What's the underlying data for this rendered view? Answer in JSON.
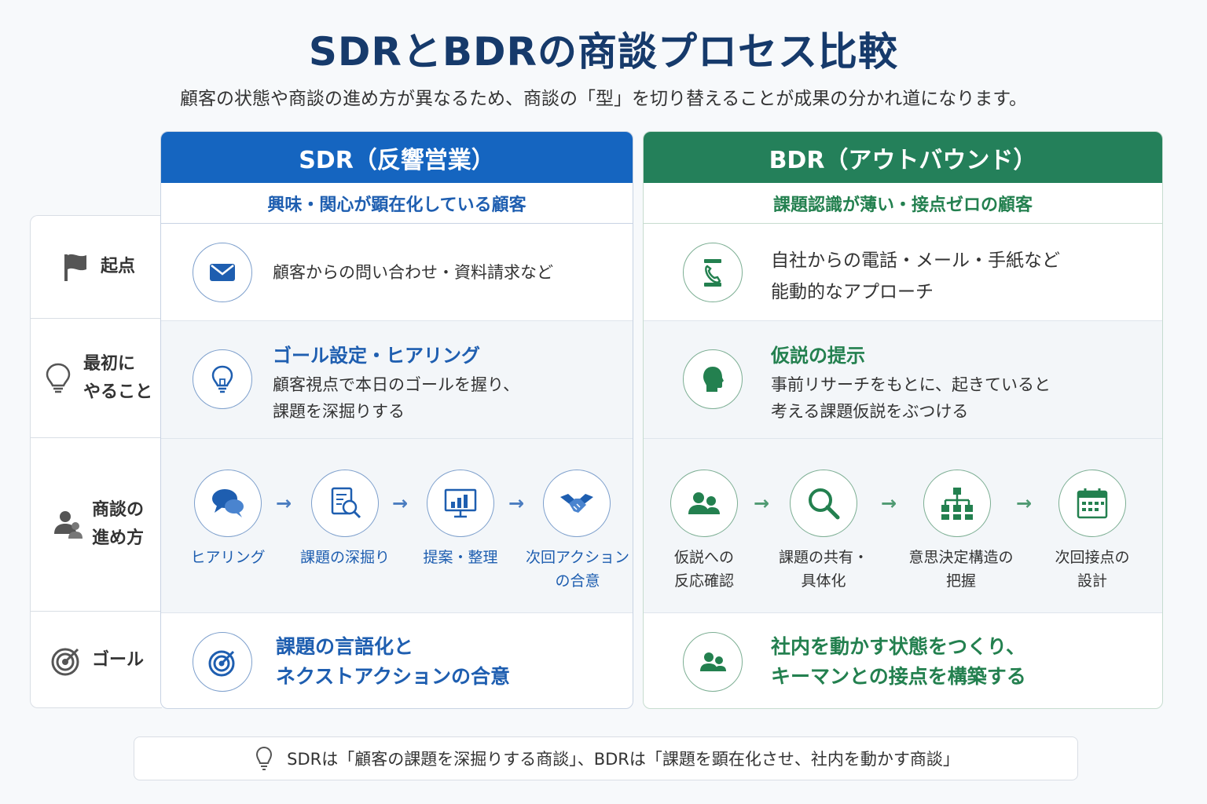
{
  "title": "SDRとBDRの商談プロセス比較",
  "subtitle": "顧客の状態や商談の進め方が異なるため、商談の「型」を切り替えることが成果の分かれ道になります。",
  "row_labels": [
    {
      "label": "起点",
      "icon": "flag-icon"
    },
    {
      "label": "最初に\nやること",
      "icon": "lightbulb-icon"
    },
    {
      "label": "商談の\n進め方",
      "icon": "people-icon"
    },
    {
      "label": "ゴール",
      "icon": "target-icon"
    }
  ],
  "sdr": {
    "header": "SDR（反響営業）",
    "subheader": "興味・関心が顕在化している顧客",
    "color": "#1565c0",
    "start": {
      "icon": "envelope-icon",
      "text": "顧客からの問い合わせ・資料請求など"
    },
    "first": {
      "icon": "lightbulb-icon",
      "heading": "ゴール設定・ヒアリング",
      "text": "顧客視点で本日のゴールを握り、\n課題を深掘りする"
    },
    "steps": [
      {
        "icon": "chat-bubbles-icon",
        "label": "ヒアリング"
      },
      {
        "icon": "document-search-icon",
        "label": "課題の深掘り"
      },
      {
        "icon": "presentation-chart-icon",
        "label": "提案・整理"
      },
      {
        "icon": "handshake-icon",
        "label": "次回アクション\nの合意"
      }
    ],
    "goal": {
      "icon": "target-icon",
      "text": "課題の言語化と\nネクストアクションの合意"
    }
  },
  "bdr": {
    "header": "BDR（アウトバウンド）",
    "subheader": "課題認識が薄い・接点ゼロの顧客",
    "color": "#24805a",
    "start": {
      "icon": "phone-icon",
      "text": "自社からの電話・メール・手紙など\n能動的なアプローチ"
    },
    "first": {
      "icon": "head-silhouette-icon",
      "heading": "仮説の提示",
      "text": "事前リサーチをもとに、起きていると\n考える課題仮説をぶつける"
    },
    "steps": [
      {
        "icon": "users-icon",
        "label": "仮説への\n反応確認"
      },
      {
        "icon": "magnifier-icon",
        "label": "課題の共有・\n具体化"
      },
      {
        "icon": "org-chart-icon",
        "label": "意思決定構造の\n把握"
      },
      {
        "icon": "calendar-icon",
        "label": "次回接点の\n設計"
      }
    ],
    "goal": {
      "icon": "users-icon",
      "text": "社内を動かす状態をつくり、\nキーマンとの接点を構築する"
    }
  },
  "arrow": "→",
  "footer": "SDRは「顧客の課題を深掘りする商談」、BDRは「課題を顕在化させ、社内を動かす商談」"
}
